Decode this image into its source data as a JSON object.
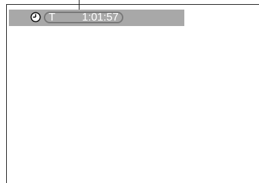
{
  "osd": {
    "icon": "clock-icon",
    "time_mode": "T",
    "time_value": "1:01:57",
    "colors": {
      "bar": "#a8a8a8",
      "text": "#ffffff",
      "pill_border": "#777777",
      "frame": "#1a1a1a"
    }
  }
}
